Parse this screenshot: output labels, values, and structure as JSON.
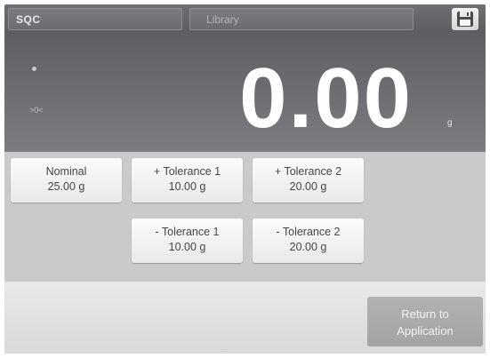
{
  "topbar": {
    "app_name": "SQC",
    "library_label": "Library",
    "save_icon": "save-icon"
  },
  "display": {
    "status_text": ">0<",
    "weight": "0.00",
    "unit": "g"
  },
  "parameters": {
    "nominal": {
      "label": "Nominal",
      "value": "25.00 g"
    },
    "plus_tol_1": {
      "label": "+ Tolerance 1",
      "value": "10.00 g"
    },
    "plus_tol_2": {
      "label": "+ Tolerance 2",
      "value": "20.00 g"
    },
    "minus_tol_1": {
      "label": "- Tolerance 1",
      "value": "10.00 g"
    },
    "minus_tol_2": {
      "label": "- Tolerance 2",
      "value": "20.00 g"
    }
  },
  "bottom": {
    "return_line1": "Return to",
    "return_line2": "Application"
  }
}
